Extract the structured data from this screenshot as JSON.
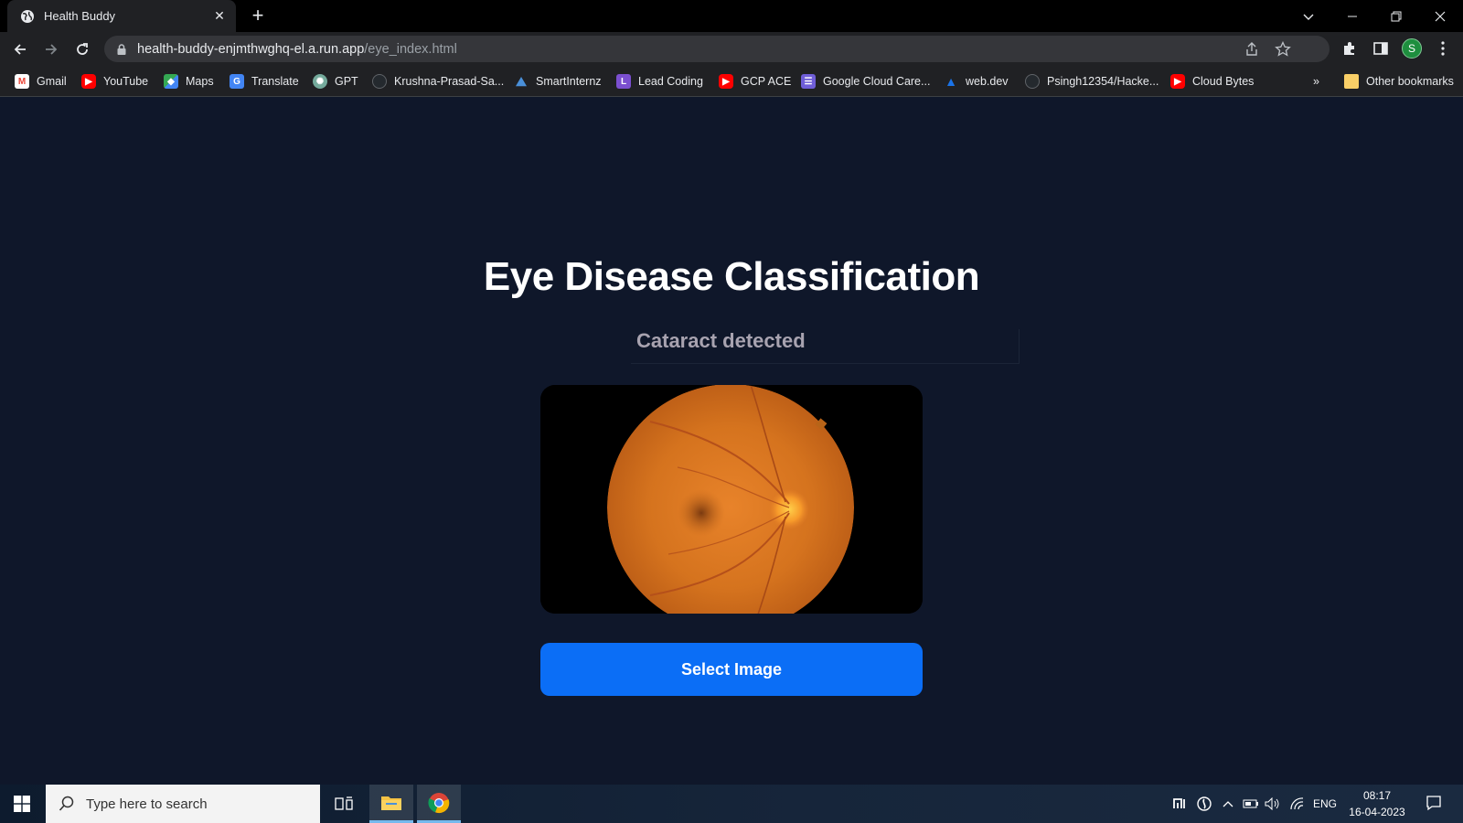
{
  "browser": {
    "tab_title": "Health Buddy",
    "url_host": "health-buddy-enjmthwghq-el.a.run.app",
    "url_path": "/eye_index.html",
    "profile_initial": "S"
  },
  "bookmarks": [
    {
      "label": "Gmail",
      "icon": "gmail-icon",
      "color": "#ea4335"
    },
    {
      "label": "YouTube",
      "icon": "youtube-icon",
      "color": "#ff0000"
    },
    {
      "label": "Maps",
      "icon": "maps-icon",
      "color": "#34a853"
    },
    {
      "label": "Translate",
      "icon": "translate-icon",
      "color": "#4285f4"
    },
    {
      "label": "GPT",
      "icon": "openai-icon",
      "color": "#74aa9c"
    },
    {
      "label": "Krushna-Prasad-Sa...",
      "icon": "github-icon",
      "color": "#24292e"
    },
    {
      "label": "SmartInternz",
      "icon": "smartinternz-icon",
      "color": "#4a90d9"
    },
    {
      "label": "Lead Coding",
      "icon": "leadcoding-icon",
      "color": "#7b4fd0"
    },
    {
      "label": "GCP ACE",
      "icon": "youtube-icon",
      "color": "#ff0000"
    },
    {
      "label": "Google Cloud Care...",
      "icon": "google-cloud-icon",
      "color": "#6f5ed8"
    },
    {
      "label": "web.dev",
      "icon": "webdev-icon",
      "color": "#1a73e8"
    },
    {
      "label": "Psingh12354/Hacke...",
      "icon": "github-icon",
      "color": "#24292e"
    },
    {
      "label": "Cloud Bytes",
      "icon": "youtube-icon",
      "color": "#ff0000"
    }
  ],
  "bookmarks_overflow": "»",
  "other_bookmarks": "Other bookmarks",
  "page": {
    "heading": "Eye Disease Classification",
    "result": "Cataract detected",
    "button_label": "Select Image"
  },
  "taskbar": {
    "search_placeholder": "Type here to search",
    "language": "ENG",
    "time": "08:17",
    "date": "16-04-2023"
  },
  "colors": {
    "page_bg": "#0f172a",
    "button": "#0b6ef6",
    "result_text": "#a8a3b0"
  }
}
